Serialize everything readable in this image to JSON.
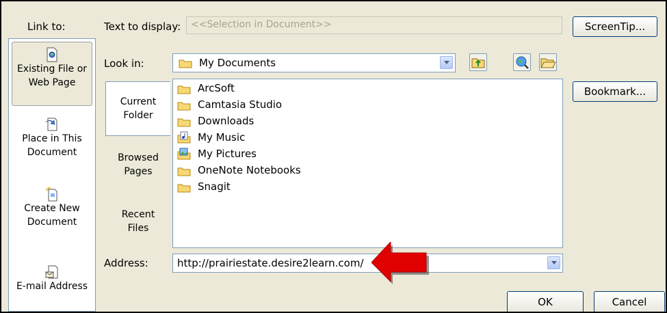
{
  "link_to": {
    "label": "Link to:",
    "items": [
      {
        "line1": "Existing File or",
        "line2": "Web Page",
        "icon": "existing-file-icon"
      },
      {
        "line1": "Place in This",
        "line2": "Document",
        "icon": "place-in-document-icon"
      },
      {
        "line1": "Create New",
        "line2": "Document",
        "icon": "new-document-icon"
      },
      {
        "line1": "E-mail Address",
        "line2": "",
        "icon": "email-icon"
      }
    ]
  },
  "text_to_display": {
    "label": "Text to display:",
    "value": "<<Selection in Document>>"
  },
  "screentip_label": "ScreenTip...",
  "look_in": {
    "label": "Look in:",
    "value": "My Documents"
  },
  "bookmark_label": "Bookmark...",
  "tabs": [
    {
      "line1": "Current",
      "line2": "Folder"
    },
    {
      "line1": "Browsed",
      "line2": "Pages"
    },
    {
      "line1": "Recent",
      "line2": "Files"
    }
  ],
  "files": [
    {
      "name": "ArcSoft",
      "icon": "folder-icon"
    },
    {
      "name": "Camtasia Studio",
      "icon": "folder-icon"
    },
    {
      "name": "Downloads",
      "icon": "folder-icon"
    },
    {
      "name": "My Music",
      "icon": "music-folder-icon"
    },
    {
      "name": "My Pictures",
      "icon": "pictures-folder-icon"
    },
    {
      "name": "OneNote Notebooks",
      "icon": "folder-icon"
    },
    {
      "name": "Snagit",
      "icon": "folder-icon"
    }
  ],
  "address": {
    "label": "Address:",
    "value": "http://prairiestate.desire2learn.com/"
  },
  "ok_label": "OK",
  "cancel_label": "Cancel",
  "colors": {
    "highlight_arrow": "#e00000",
    "dialog_bg": "#ece9d8",
    "field_border": "#7f9db9"
  }
}
